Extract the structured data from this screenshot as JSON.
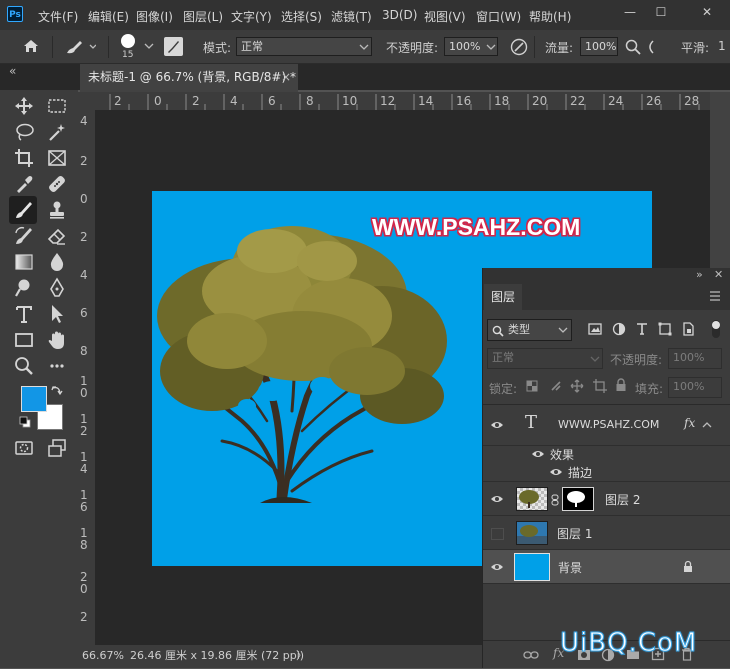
{
  "app": {
    "logo_text": "Ps"
  },
  "menu": [
    "文件(F)",
    "编辑(E)",
    "图像(I)",
    "图层(L)",
    "文字(Y)",
    "选择(S)",
    "滤镜(T)",
    "3D(D)",
    "视图(V)",
    "窗口(W)",
    "帮助(H)"
  ],
  "window_controls": {
    "minimize": "—",
    "maximize": "☐",
    "close": "✕"
  },
  "options": {
    "brush_size": "15",
    "mode_label": "模式:",
    "mode_value": "正常",
    "opacity_label": "不透明度:",
    "opacity_value": "100%",
    "flow_label": "流量:",
    "flow_value": "100%",
    "smoothing_label": "平滑:",
    "smoothing_value": "1"
  },
  "document_tab": {
    "title": "未标题-1 @ 66.7% (背景, RGB/8#) *",
    "close": "×"
  },
  "collapse_glyph": "«",
  "ruler_top": [
    "2",
    "0",
    "2",
    "4",
    "6",
    "8",
    "10",
    "12",
    "14",
    "16",
    "18",
    "20",
    "22",
    "24",
    "26",
    "28"
  ],
  "ruler_left": [
    "4",
    "2",
    "0",
    "2",
    "4",
    "6",
    "8",
    "1",
    "0",
    "1",
    "2",
    "1",
    "4",
    "1",
    "6",
    "1",
    "8",
    "2",
    "0",
    "2"
  ],
  "canvas": {
    "background_color": "#00a0e8",
    "watermark_text": "WWW.PSAHZ.COM"
  },
  "status": {
    "zoom": "66.67%",
    "doc_size": "26.46 厘米 x 19.86 厘米 (72 ppi)",
    "arrow": "〉"
  },
  "colors": {
    "foreground": "#1296e6",
    "background": "#ffffff"
  },
  "layers_panel": {
    "tab": "图层",
    "filter_type": "类型",
    "blend_mode": "正常",
    "opacity_label": "不透明度:",
    "opacity_value": "100%",
    "lock_label": "锁定:",
    "fill_label": "填充:",
    "fill_value": "100%",
    "layers": [
      {
        "name": "WWW.PSAHZ.COM",
        "kind": "text",
        "type_glyph": "T",
        "fx": "fx",
        "visible": true
      },
      {
        "name": "图层 2",
        "kind": "masked",
        "visible": true
      },
      {
        "name": "图层 1",
        "kind": "image",
        "visible": false
      },
      {
        "name": "背景",
        "kind": "background",
        "visible": true,
        "locked": true
      }
    ],
    "effects_label": "效果",
    "stroke_label": "描边",
    "footer_icons": [
      "link-icon",
      "fx-icon",
      "add-mask-icon",
      "adjustment-icon",
      "group-icon",
      "new-layer-icon",
      "delete-icon"
    ],
    "footer_fx": "fx"
  },
  "site_watermark": "UiBQ.CoM"
}
